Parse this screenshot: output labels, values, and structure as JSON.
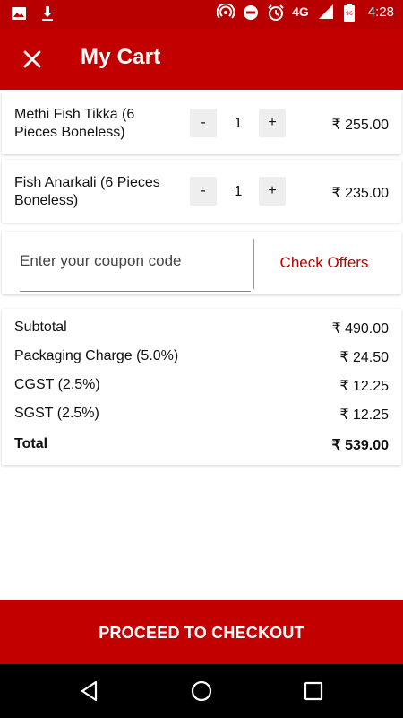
{
  "status_bar": {
    "network": "4G",
    "time": "4:28"
  },
  "header": {
    "title": "My Cart"
  },
  "items": [
    {
      "name": "Methi Fish Tikka (6 Pieces Boneless)",
      "qty": "1",
      "minus": "-",
      "plus": "+",
      "price": "₹ 255.00"
    },
    {
      "name": "Fish Anarkali (6 Pieces Boneless)",
      "qty": "1",
      "minus": "-",
      "plus": "+",
      "price": "₹ 235.00"
    }
  ],
  "coupon": {
    "placeholder": "Enter your coupon code",
    "value": "",
    "check_offers": "Check Offers"
  },
  "summary": {
    "subtotal": {
      "label": "Subtotal",
      "value": "₹ 490.00"
    },
    "packaging": {
      "label": "Packaging Charge (5.0%)",
      "value": "₹ 24.50"
    },
    "cgst": {
      "label": "CGST (2.5%)",
      "value": "₹ 12.25"
    },
    "sgst": {
      "label": "SGST (2.5%)",
      "value": "₹ 12.25"
    },
    "total": {
      "label": "Total",
      "value": "₹ 539.00"
    }
  },
  "checkout": {
    "label": "PROCEED TO CHECKOUT"
  },
  "colors": {
    "brand": "#c30000",
    "status": "#b80000",
    "accent_text": "#b80000"
  }
}
